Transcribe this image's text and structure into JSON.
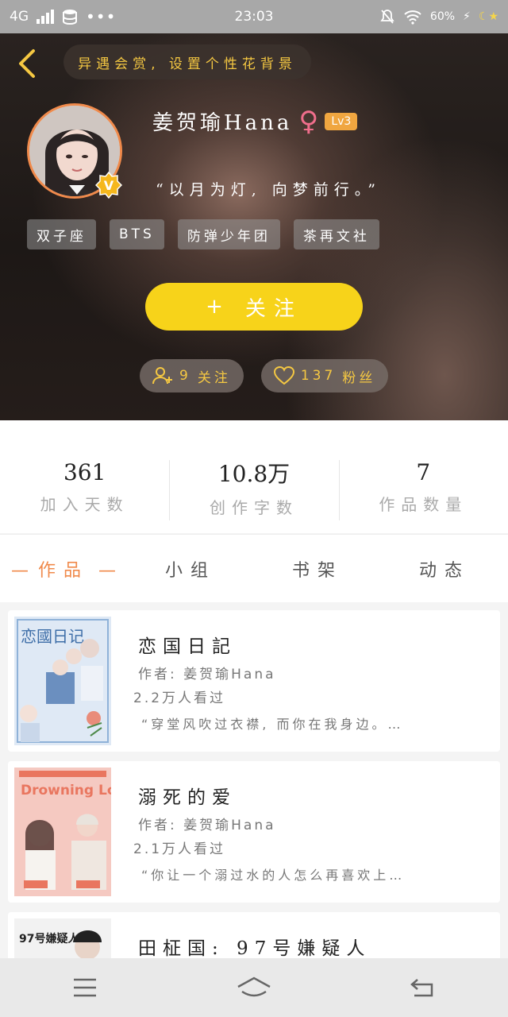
{
  "status_bar": {
    "network": "4G",
    "time": "23:03",
    "battery": "60%"
  },
  "header": {
    "title_pill": "异遇会赏, 设置个性花背景",
    "user": {
      "name": "姜贺瑜Hana",
      "gender_symbol": "♀",
      "level": "Lv3",
      "signature": "“以月为灯, 向梦前行。”"
    },
    "tags": [
      "双子座",
      "BTS",
      "防弹少年团",
      "茶再文社"
    ],
    "follow_button": {
      "plus": "+",
      "label": "关注"
    },
    "following": {
      "count": "9",
      "label": "关注"
    },
    "fans": {
      "count": "137",
      "label": "粉丝"
    }
  },
  "stats": [
    {
      "value": "361",
      "label": "加入天数"
    },
    {
      "value": "10.8万",
      "label": "创作字数"
    },
    {
      "value": "7",
      "label": "作品数量"
    }
  ],
  "tabs": [
    {
      "label": "作品",
      "active": true
    },
    {
      "label": "小组",
      "active": false
    },
    {
      "label": "书架",
      "active": false
    },
    {
      "label": "动态",
      "active": false
    }
  ],
  "works": [
    {
      "title": "恋国日記",
      "author": "作者: 姜贺瑜Hana",
      "views": "2.2万人看过",
      "excerpt": "“穿堂风吹过衣襟, 而你在我身边。…",
      "cover_text": "恋國日记"
    },
    {
      "title": "溺死的爱",
      "author": "作者: 姜贺瑜Hana",
      "views": "2.1万人看过",
      "excerpt": "“你让一个溺过水的人怎么再喜欢上…",
      "cover_text": "Drowning Love"
    },
    {
      "title": "田柾国: 97号嫌疑人",
      "author": "",
      "views": "",
      "excerpt": "",
      "cover_text": "97号嫌疑人"
    }
  ],
  "colors": {
    "accent_orange": "#f08a4b",
    "follow_yellow": "#f7d31a",
    "pill_text_gold": "#f5c842"
  }
}
